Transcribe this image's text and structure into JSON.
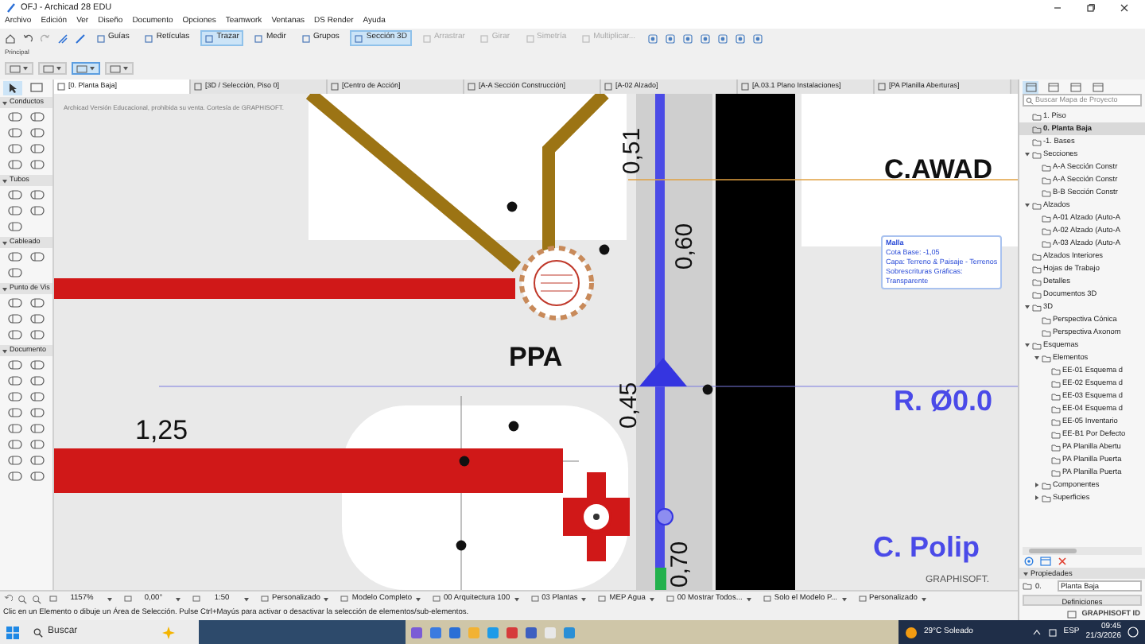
{
  "window": {
    "title": "OFJ - Archicad 28 EDU"
  },
  "menu": [
    "Archivo",
    "Edición",
    "Ver",
    "Diseño",
    "Documento",
    "Opciones",
    "Teamwork",
    "Ventanas",
    "DS Render",
    "Ayuda"
  ],
  "toolbar": [
    {
      "label": "Guías",
      "selected": false,
      "disabled": false
    },
    {
      "label": "Retículas",
      "selected": false,
      "disabled": false
    },
    {
      "label": "Trazar",
      "selected": true,
      "disabled": false
    },
    {
      "label": "Medir",
      "selected": false,
      "disabled": false
    },
    {
      "label": "Grupos",
      "selected": false,
      "disabled": false
    },
    {
      "label": "Sección 3D",
      "selected": true,
      "disabled": false
    },
    {
      "label": "Arrastrar",
      "selected": false,
      "disabled": true
    },
    {
      "label": "Girar",
      "selected": false,
      "disabled": true
    },
    {
      "label": "Simetría",
      "selected": false,
      "disabled": true
    },
    {
      "label": "Multiplicar...",
      "selected": false,
      "disabled": true
    }
  ],
  "toolbar_label": "Principal",
  "quick_options": [
    {
      "selected": false
    },
    {
      "selected": false
    },
    {
      "selected": true
    },
    {
      "selected": false
    }
  ],
  "tabs": [
    {
      "label": "[0. Planta Baja]",
      "selected": true
    },
    {
      "label": "[3D / Selección, Piso 0]",
      "selected": false
    },
    {
      "label": "[Centro de Acción]",
      "selected": false
    },
    {
      "label": "[A-A Sección Construcción]",
      "selected": false
    },
    {
      "label": "[A-02 Alzado]",
      "selected": false
    },
    {
      "label": "[A.03.1 Plano Instalaciones]",
      "selected": false
    },
    {
      "label": "[PA Planilla Aberturas]",
      "selected": false
    }
  ],
  "toolbox": {
    "pointer_tools": [
      {
        "selected": true
      },
      {
        "selected": false
      }
    ],
    "sections": [
      {
        "title": "Conductos",
        "expanded": true
      },
      {
        "title": "Tubos",
        "expanded": true
      },
      {
        "title": "Cableado",
        "expanded": true
      },
      {
        "title": "Punto de Vis",
        "expanded": true
      },
      {
        "title": "Documento",
        "expanded": true
      }
    ]
  },
  "canvas": {
    "notice": "Archicad Versión Educacional, prohibida su venta. Cortesía de GRAPHISOFT.",
    "annotations": [
      {
        "text": "C.AWAD",
        "kind": "label"
      },
      {
        "text": "0,51",
        "kind": "dimension"
      },
      {
        "text": "0,60",
        "kind": "dimension"
      },
      {
        "text": "PPA",
        "kind": "label"
      },
      {
        "text": "0,45",
        "kind": "dimension"
      },
      {
        "text": "R. Ø0.0",
        "kind": "pipe_label"
      },
      {
        "text": "1,25",
        "kind": "plain"
      },
      {
        "text": "C. Polip",
        "kind": "pipe_label"
      },
      {
        "text": "0,70",
        "kind": "dimension"
      }
    ],
    "logo": "GRAPHISOFT.",
    "tooltip": [
      "Malla",
      "Cota Base: -1,05",
      "Capa: Terreno & Paisaje - Terrenos",
      "Sobrescrituras Gráficas:",
      "Transparente"
    ]
  },
  "navigator": {
    "view_buttons": [
      {
        "selected": true
      },
      {
        "selected": false
      },
      {
        "selected": false
      },
      {
        "selected": false
      }
    ],
    "search": {
      "placeholder": "Buscar Mapa de Proyecto"
    },
    "tree": [
      {
        "label": "1. Piso",
        "selected": false
      },
      {
        "label": "0. Planta Baja",
        "selected": true
      },
      {
        "label": "-1. Bases",
        "selected": false
      },
      {
        "label": "Secciones",
        "selected": false,
        "expanded": true,
        "children": [
          {
            "label": "A-A Sección Constr",
            "selected": false
          },
          {
            "label": "A-A Sección Constr",
            "selected": false
          },
          {
            "label": "B-B Sección Constr",
            "selected": false
          }
        ]
      },
      {
        "label": "Alzados",
        "selected": false,
        "expanded": true,
        "children": [
          {
            "label": "A-01 Alzado (Auto-A",
            "selected": false
          },
          {
            "label": "A-02 Alzado (Auto-A",
            "selected": false
          },
          {
            "label": "A-03 Alzado (Auto-A",
            "selected": false
          }
        ]
      },
      {
        "label": "Alzados Interiores",
        "selected": false
      },
      {
        "label": "Hojas de Trabajo",
        "selected": false
      },
      {
        "label": "Detalles",
        "selected": false
      },
      {
        "label": "Documentos 3D",
        "selected": false
      },
      {
        "label": "3D",
        "selected": false,
        "expanded": true,
        "children": [
          {
            "label": "Perspectiva Cónica",
            "selected": false
          },
          {
            "label": "Perspectiva Axonom",
            "selected": false
          }
        ]
      },
      {
        "label": "Esquemas",
        "selected": false,
        "expanded": true,
        "children": [
          {
            "label": "Elementos",
            "selected": false,
            "expanded": true,
            "children": [
              {
                "label": "EE-01 Esquema d",
                "selected": false
              },
              {
                "label": "EE-02 Esquema d",
                "selected": false
              },
              {
                "label": "EE-03 Esquema d",
                "selected": false
              },
              {
                "label": "EE-04 Esquema d",
                "selected": false
              },
              {
                "label": "EE-05 Inventario",
                "selected": false
              },
              {
                "label": "EE-B1 Por Defecto",
                "selected": false
              },
              {
                "label": "PA Planilla Abertu",
                "selected": false
              },
              {
                "label": "PA Planilla Puerta",
                "selected": false
              },
              {
                "label": "PA Planilla Puerta",
                "selected": false
              }
            ]
          },
          {
            "label": "Componentes",
            "selected": false,
            "expanded": false
          },
          {
            "label": "Superficies",
            "selected": false,
            "expanded": false
          }
        ]
      }
    ]
  },
  "properties": {
    "title": "Propiedades",
    "expanded": true,
    "id": "0.",
    "name": "Planta Baja",
    "button": "Definiciones"
  },
  "graphisoft_id": "GRAPHISOFT ID",
  "status_bar": {
    "zoom": "1157%",
    "angle": "0,00°",
    "scale": "1:50",
    "items": [
      "Personalizado",
      "Modelo Completo",
      "00 Arquitectura 100",
      "03 Plantas",
      "MEP Agua",
      "00 Mostrar Todos...",
      "Solo el Modelo P...",
      "Personalizado"
    ]
  },
  "message": "Clic en un Elemento o dibuje un Área de Selección. Pulse Ctrl+Mayús para activar o desactivar la selección de elementos/sub-elementos.",
  "taskbar": {
    "search": "Buscar",
    "weather": "29°C Soleado",
    "language": "ESP",
    "time": "09:45",
    "date": "21/3/2026"
  }
}
